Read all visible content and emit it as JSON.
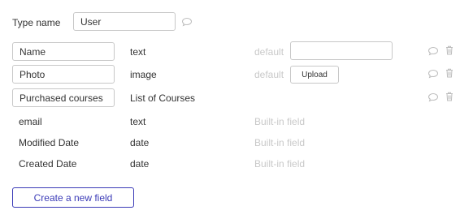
{
  "type_name": {
    "label": "Type name",
    "value": "User"
  },
  "fields": [
    {
      "name": "Name",
      "type": "text",
      "default_label": "default",
      "default_value": ""
    },
    {
      "name": "Photo",
      "type": "image",
      "default_label": "default",
      "upload_label": "Upload"
    },
    {
      "name": "Purchased courses",
      "type": "List of Courses"
    }
  ],
  "builtin_fields": [
    {
      "name": "email",
      "type": "text",
      "note": "Built-in field"
    },
    {
      "name": "Modified Date",
      "type": "date",
      "note": "Built-in field"
    },
    {
      "name": "Created Date",
      "type": "date",
      "note": "Built-in field"
    }
  ],
  "create_button_label": "Create a new field",
  "icons": {
    "comment": "comment-icon",
    "trash": "trash-icon"
  },
  "colors": {
    "accent": "#3b3bb7",
    "muted_text": "#c9c9c9",
    "border": "#c8c8c8"
  }
}
